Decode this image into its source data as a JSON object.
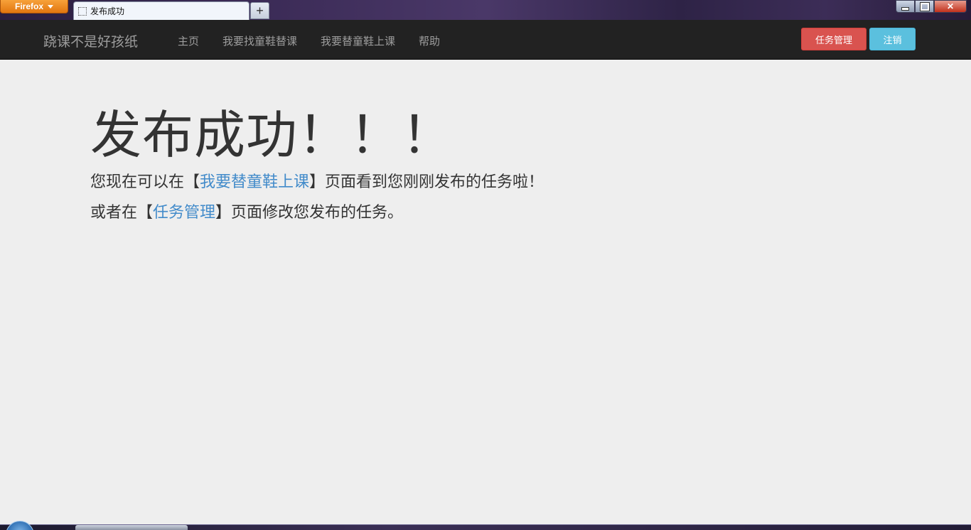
{
  "browser": {
    "app_button_label": "Firefox",
    "tab_title": "发布成功",
    "new_tab_label": "+"
  },
  "navbar": {
    "brand": "跷课不是好孩纸",
    "links": [
      "主页",
      "我要找童鞋替课",
      "我要替童鞋上课",
      "帮助"
    ],
    "task_button": "任务管理",
    "logout_button": "注销"
  },
  "content": {
    "headline": "发布成功！！！",
    "line1_prefix": "您现在可以在【",
    "line1_link": "我要替童鞋上课",
    "line1_suffix": "】页面看到您刚刚发布的任务啦！",
    "line2_prefix": "或者在【",
    "line2_link": "任务管理",
    "line2_suffix": "】页面修改您发布的任务。"
  },
  "colors": {
    "navbar_bg": "#222222",
    "page_bg": "#eeeeee",
    "link": "#428bca",
    "danger_button": "#d9534f",
    "info_button": "#5bc0de"
  }
}
